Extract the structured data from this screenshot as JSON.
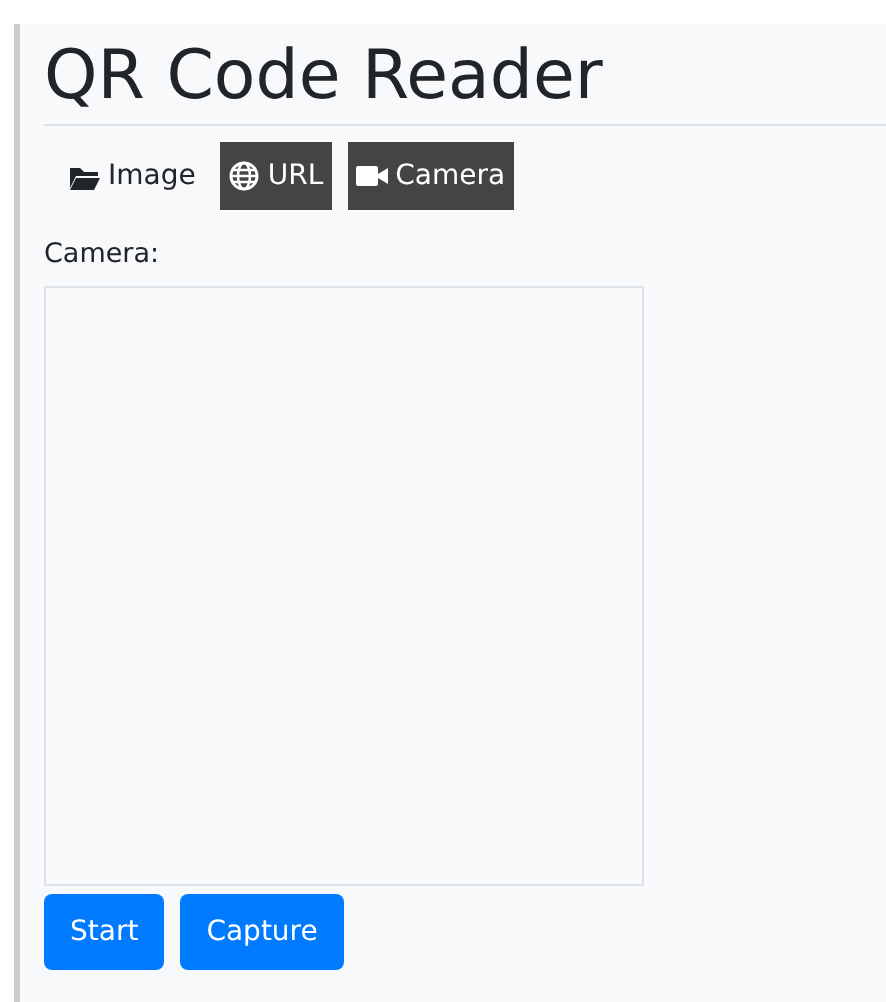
{
  "title": "QR Code Reader",
  "tabs": [
    {
      "label": "Image",
      "kind": "folder",
      "selected": false
    },
    {
      "label": "URL",
      "kind": "globe",
      "selected": true
    },
    {
      "label": "Camera",
      "kind": "camera",
      "selected": true
    }
  ],
  "camera_label": "Camera:",
  "buttons": [
    "Start",
    "Capture"
  ]
}
